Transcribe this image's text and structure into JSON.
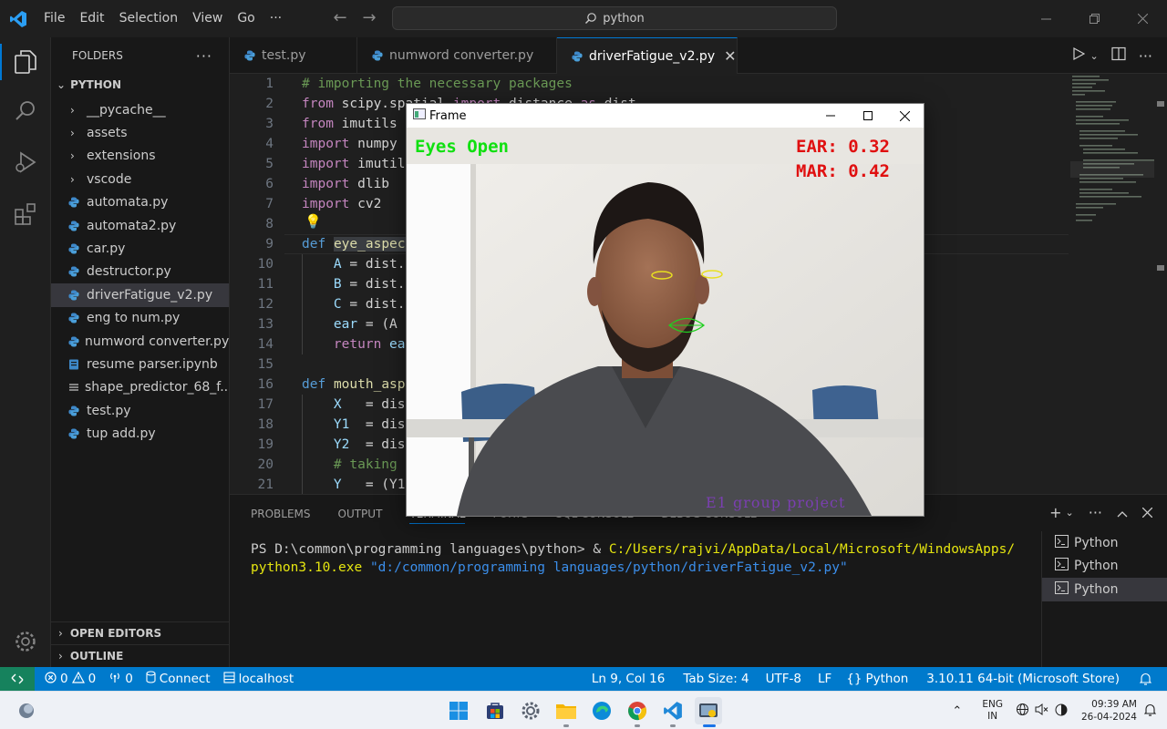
{
  "titlebar": {
    "menu": [
      "File",
      "Edit",
      "Selection",
      "View",
      "Go",
      "···"
    ],
    "search": "python"
  },
  "sidebar": {
    "header": "FOLDERS",
    "root": "PYTHON",
    "items": [
      {
        "label": "__pycache__",
        "type": "folder"
      },
      {
        "label": "assets",
        "type": "folder"
      },
      {
        "label": "extensions",
        "type": "folder"
      },
      {
        "label": "vscode",
        "type": "folder"
      },
      {
        "label": "automata.py",
        "type": "py"
      },
      {
        "label": "automata2.py",
        "type": "py"
      },
      {
        "label": "car.py",
        "type": "py"
      },
      {
        "label": "destructor.py",
        "type": "py"
      },
      {
        "label": "driverFatigue_v2.py",
        "type": "py",
        "selected": true
      },
      {
        "label": "eng to num.py",
        "type": "py"
      },
      {
        "label": "numword converter.py",
        "type": "py"
      },
      {
        "label": "resume parser.ipynb",
        "type": "nb"
      },
      {
        "label": "shape_predictor_68_f...",
        "type": "dat"
      },
      {
        "label": "test.py",
        "type": "py"
      },
      {
        "label": "tup add.py",
        "type": "py"
      }
    ],
    "open_editors": "OPEN EDITORS",
    "outline": "OUTLINE"
  },
  "tabs": [
    {
      "label": "test.py",
      "active": false
    },
    {
      "label": "numword converter.py",
      "active": false
    },
    {
      "label": "driverFatigue_v2.py",
      "active": true
    }
  ],
  "editor": {
    "lines": [
      {
        "n": "1",
        "parts": [
          [
            "cm",
            "# importing the necessary packages"
          ]
        ]
      },
      {
        "n": "2",
        "parts": [
          [
            "kw",
            "from"
          ],
          [
            "tx",
            " scipy.spatial "
          ],
          [
            "kw",
            "import"
          ],
          [
            "tx",
            " distance "
          ],
          [
            "kw",
            "as"
          ],
          [
            "tx",
            " dist"
          ]
        ]
      },
      {
        "n": "3",
        "parts": [
          [
            "kw",
            "from"
          ],
          [
            "tx",
            " imutils"
          ]
        ]
      },
      {
        "n": "4",
        "parts": [
          [
            "kw",
            "import"
          ],
          [
            "tx",
            " numpy"
          ]
        ]
      },
      {
        "n": "5",
        "parts": [
          [
            "kw",
            "import"
          ],
          [
            "tx",
            " imutil"
          ]
        ]
      },
      {
        "n": "6",
        "parts": [
          [
            "kw",
            "import"
          ],
          [
            "tx",
            " dlib"
          ]
        ]
      },
      {
        "n": "7",
        "parts": [
          [
            "kw",
            "import"
          ],
          [
            "tx",
            " cv2"
          ]
        ]
      },
      {
        "n": "8",
        "parts": []
      },
      {
        "n": "9",
        "parts": [
          [
            "kw2",
            "def"
          ],
          [
            "tx",
            " "
          ],
          [
            "fn",
            "eye_aspec"
          ]
        ]
      },
      {
        "n": "10",
        "parts": [
          [
            "tx",
            "    "
          ],
          [
            "vr",
            "A"
          ],
          [
            "tx",
            " = dist."
          ]
        ]
      },
      {
        "n": "11",
        "parts": [
          [
            "tx",
            "    "
          ],
          [
            "vr",
            "B"
          ],
          [
            "tx",
            " = dist."
          ]
        ]
      },
      {
        "n": "12",
        "parts": [
          [
            "tx",
            "    "
          ],
          [
            "vr",
            "C"
          ],
          [
            "tx",
            " = dist."
          ]
        ]
      },
      {
        "n": "13",
        "parts": [
          [
            "tx",
            "    "
          ],
          [
            "vr",
            "ear"
          ],
          [
            "tx",
            " = (A"
          ]
        ]
      },
      {
        "n": "14",
        "parts": [
          [
            "tx",
            "    "
          ],
          [
            "kw",
            "return"
          ],
          [
            "tx",
            " "
          ],
          [
            "vr",
            "ea"
          ]
        ]
      },
      {
        "n": "15",
        "parts": []
      },
      {
        "n": "16",
        "parts": [
          [
            "kw2",
            "def"
          ],
          [
            "tx",
            " "
          ],
          [
            "fn",
            "mouth_asp"
          ]
        ]
      },
      {
        "n": "17",
        "parts": [
          [
            "tx",
            "    "
          ],
          [
            "vr",
            "X"
          ],
          [
            "tx",
            "   = dis"
          ]
        ]
      },
      {
        "n": "18",
        "parts": [
          [
            "tx",
            "    "
          ],
          [
            "vr",
            "Y1"
          ],
          [
            "tx",
            "  = dis"
          ]
        ]
      },
      {
        "n": "19",
        "parts": [
          [
            "tx",
            "    "
          ],
          [
            "vr",
            "Y2"
          ],
          [
            "tx",
            "  = dis"
          ]
        ]
      },
      {
        "n": "20",
        "parts": [
          [
            "tx",
            "    "
          ],
          [
            "cm",
            "# taking"
          ]
        ]
      },
      {
        "n": "21",
        "parts": [
          [
            "tx",
            "    "
          ],
          [
            "vr",
            "Y"
          ],
          [
            "tx",
            "   = (Y1"
          ]
        ]
      }
    ]
  },
  "panel": {
    "tabs": [
      "PROBLEMS",
      "OUTPUT",
      "TERMINAL",
      "PORTS",
      "SQL CONSOLE",
      "DEBUG CONSOLE"
    ],
    "active_tab": "TERMINAL",
    "terminal": {
      "prompt": "PS D:\\common\\programming languages\\python> & ",
      "exe": "C:/Users/rajvi/AppData/Local/Microsoft/WindowsApps/python3.10.exe",
      "arg": " \"d:/common/programming languages/python/driverFatigue_v2.py\""
    },
    "terminals": [
      "Python",
      "Python",
      "Python"
    ]
  },
  "statusbar": {
    "errors": "0",
    "warnings": "0",
    "ports": "0",
    "connect": "Connect",
    "host": "localhost",
    "cursor": "Ln 9, Col 16",
    "tabsize": "Tab Size: 4",
    "encoding": "UTF-8",
    "eol": "LF",
    "language": "Python",
    "interpreter": "3.10.11 64-bit (Microsoft Store)"
  },
  "frame_window": {
    "title": "Frame",
    "status": "Eyes Open",
    "ear": "EAR: 0.32",
    "mar": "MAR: 0.42",
    "watermark": "E1 group  project",
    "colors": {
      "status": "#10e010",
      "metrics": "#e01010",
      "watermark": "#7a3fb0"
    }
  },
  "taskbar": {
    "lang": "ENG",
    "region": "IN",
    "time": "09:39 AM",
    "date": "26-04-2024"
  }
}
